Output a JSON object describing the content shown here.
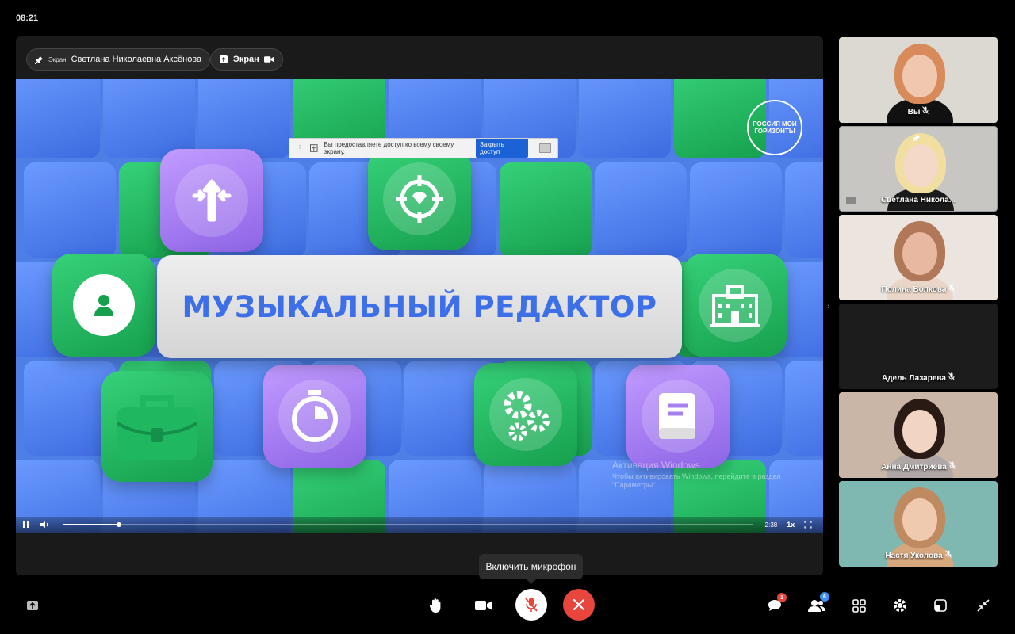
{
  "status_bar": {
    "time": "08:21"
  },
  "stage": {
    "owner_chip": {
      "small_label": "Экран",
      "name": "Светлана Николаевна Аксёнова"
    },
    "screen_chip": {
      "label": "Экран"
    },
    "share_banner": {
      "message": "Вы предоставляете доступ ко всему своему экрану.",
      "stop_label": "Закрыть доступ"
    },
    "slide": {
      "title": "МУЗЫКАЛЬНЫЙ РЕДАКТОР",
      "logo_text": "РОССИЯ МОИ ГОРИЗОНТЫ"
    },
    "watermark": {
      "line1": "Активация Windows",
      "line2": "Чтобы активировать Windows, перейдите в раздел",
      "line3": "\"Параметры\"."
    },
    "player": {
      "time_remaining": "-2:38",
      "speed": "1x",
      "progress_fraction": 0.08
    }
  },
  "participants": [
    {
      "name": "Вы",
      "muted": true,
      "colors": {
        "bg": "#dcd8d2",
        "hair": "#d98a5a",
        "skin": "#f0c8b0",
        "shirt": "#111111"
      }
    },
    {
      "name": "Светлана Никола...",
      "muted": false,
      "pinned": true,
      "sharing": true,
      "colors": {
        "bg": "#c8c6c2",
        "hair": "#f0dfa0",
        "skin": "#f4d8c8",
        "shirt": "#1a1a1a"
      }
    },
    {
      "name": "Полина Волкова",
      "muted": true,
      "colors": {
        "bg": "#ece4de",
        "hair": "#b07858",
        "skin": "#e8b8a0",
        "shirt": "#e9d6c8"
      }
    },
    {
      "name": "Адель Лазарева",
      "muted": true,
      "colors": {
        "bg": "#1c1c1c",
        "hair": "#1c1c1c",
        "skin": "#1c1c1c",
        "shirt": "#1c1c1c"
      }
    },
    {
      "name": "Анна Дмитриева",
      "muted": true,
      "colors": {
        "bg": "#c9b6a6",
        "hair": "#2a1a14",
        "skin": "#f2d4c2",
        "shirt": "#b0a8a6"
      }
    },
    {
      "name": "Настя Уколова",
      "muted": true,
      "colors": {
        "bg": "#7fb8b0",
        "hair": "#c08a60",
        "skin": "#f0caae",
        "shirt": "#d6a67c"
      }
    }
  ],
  "tooltip": {
    "text": "Включить микрофон"
  },
  "toolbar": {
    "left": [
      {
        "icon": "share-screen-icon"
      }
    ],
    "center": [
      {
        "icon": "raise-hand-icon"
      },
      {
        "icon": "camera-icon"
      },
      {
        "icon": "mic-off-icon"
      },
      {
        "icon": "end-call-icon"
      }
    ],
    "right": [
      {
        "icon": "chat-icon",
        "badge": "1",
        "badge_color": "#e8453c"
      },
      {
        "icon": "participants-icon",
        "badge": "6",
        "badge_color": "#3f8ef0"
      },
      {
        "icon": "grid-layout-icon"
      },
      {
        "icon": "settings-icon"
      },
      {
        "icon": "layout-icon"
      },
      {
        "icon": "collapse-icon"
      }
    ]
  },
  "colors": {
    "end_call": "#e8453c",
    "accent": "#1a62d6",
    "title_text": "#3d6fe8"
  }
}
